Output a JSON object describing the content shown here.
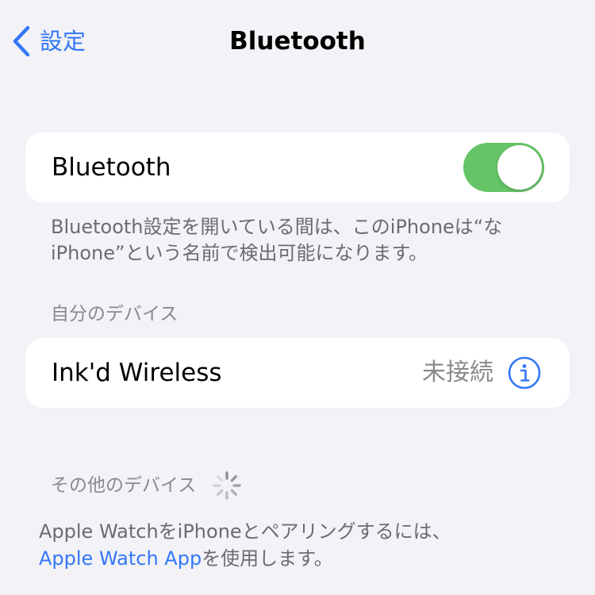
{
  "nav": {
    "back_label": "設定",
    "title": "Bluetooth"
  },
  "bluetooth": {
    "label": "Bluetooth",
    "toggle_on": true,
    "toggle_color": "#65c466",
    "footer_line1": "Bluetooth設定を開いている間は、このiPhoneは“な",
    "footer_line2": "iPhone”という名前で検出可能になります。"
  },
  "my_devices": {
    "header": "自分のデバイス",
    "items": [
      {
        "name": "Ink'd Wireless",
        "status": "未接続"
      }
    ]
  },
  "other_devices": {
    "header": "その他のデバイス",
    "pairing_line1": "Apple WatchをiPhoneとペアリングするには、",
    "pairing_link": "Apple Watch App",
    "pairing_line2_rest": "を使用します。"
  },
  "colors": {
    "accent": "#3478f6",
    "background": "#f2f2f7",
    "card": "#ffffff",
    "secondary_text": "#8a8a8e"
  },
  "icons": {
    "back": "chevron-left-icon",
    "info": "info-circle-icon",
    "spinner": "activity-spinner-icon"
  }
}
